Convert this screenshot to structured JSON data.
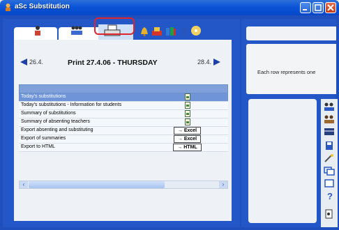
{
  "window": {
    "title": "aSc Substitution"
  },
  "tabs": [
    {
      "name": "teacher-tab-icon"
    },
    {
      "name": "people-tab-icon"
    },
    {
      "name": "print-tab-icon",
      "active": true
    },
    {
      "name": "bell-tab-icon"
    },
    {
      "name": "tray-tab-icon"
    },
    {
      "name": "books-tab-icon"
    },
    {
      "name": "arrows-tab-icon"
    },
    {
      "name": "disc-tab-icon"
    }
  ],
  "nav": {
    "prev_date": "26.4.",
    "next_date": "28.4.",
    "title": "Print 27.4.06 - THURSDAY"
  },
  "list": {
    "rows": [
      {
        "label": "Today's substitutions",
        "action": "doc"
      },
      {
        "label": "Today's substitutions - Information for students",
        "action": "doc"
      },
      {
        "label": "Summary of substitutions",
        "action": "doc"
      },
      {
        "label": "Summary of absenting teachers",
        "action": "doc"
      },
      {
        "label": "Export absenting and substituting",
        "action": "→ Excel"
      },
      {
        "label": "Export of summaries",
        "action": "→ Excel"
      },
      {
        "label": "Export to HTML",
        "action": "→ HTML"
      }
    ]
  },
  "right": {
    "info_text": "Each row represents one"
  },
  "colors": {
    "titlebar": "#0a54d8",
    "panel": "#2357c8",
    "selected_row": "#6f95d8",
    "highlight": "#e0242b"
  }
}
